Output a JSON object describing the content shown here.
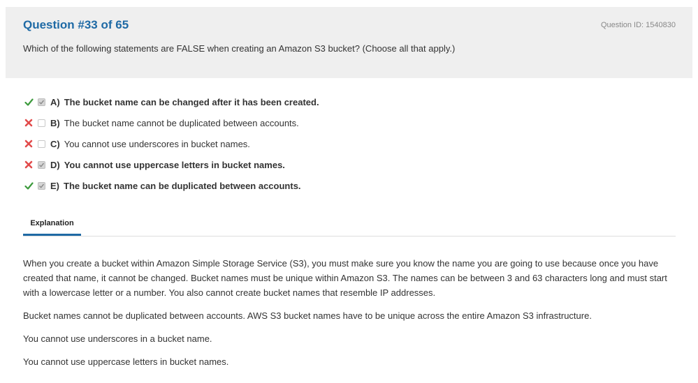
{
  "question": {
    "title": "Question #33 of 65",
    "id_label": "Question ID: 1540830",
    "text": "Which of the following statements are FALSE when creating an Amazon S3 bucket? (Choose all that apply.)"
  },
  "answers": [
    {
      "letter": "A)",
      "text": "The bucket name can be changed after it has been created.",
      "result": "correct",
      "checked": true
    },
    {
      "letter": "B)",
      "text": "The bucket name cannot be duplicated between accounts.",
      "result": "incorrect",
      "checked": false
    },
    {
      "letter": "C)",
      "text": "You cannot use underscores in bucket names.",
      "result": "incorrect",
      "checked": false
    },
    {
      "letter": "D)",
      "text": "You cannot use uppercase letters in bucket names.",
      "result": "incorrect",
      "checked": true
    },
    {
      "letter": "E)",
      "text": "The bucket name can be duplicated between accounts.",
      "result": "correct",
      "checked": true
    }
  ],
  "tabs": {
    "explanation_label": "Explanation"
  },
  "explanation": {
    "paragraphs": [
      "When you create a bucket within Amazon Simple Storage Service (S3), you must make sure you know the name you are going to use because once you have created that name, it cannot be changed. Bucket names must be unique within Amazon S3. The names can be between 3 and 63 characters long and must start with a lowercase letter or a number. You also cannot create bucket names that resemble IP addresses.",
      "Bucket names cannot be duplicated between accounts. AWS S3 bucket names have to be unique across the entire Amazon S3 infrastructure.",
      "You cannot use underscores in a bucket name.",
      "You cannot use uppercase letters in bucket names."
    ]
  },
  "colors": {
    "accent": "#1f6aa5",
    "correct": "#3c9a3c",
    "incorrect": "#e24b4b"
  },
  "icons": {
    "correct": "checkmark-icon",
    "incorrect": "cross-icon"
  }
}
